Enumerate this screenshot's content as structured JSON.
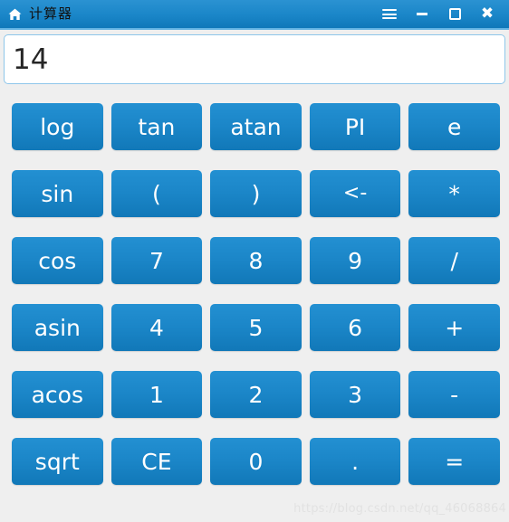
{
  "window": {
    "title": "计算器",
    "home_icon": "home-icon",
    "controls": [
      {
        "name": "menu-button",
        "icon": "hamburger-icon",
        "label": ""
      },
      {
        "name": "minimize-button",
        "icon": "minimize-icon",
        "label": ""
      },
      {
        "name": "maximize-button",
        "icon": "maximize-icon",
        "label": ""
      },
      {
        "name": "close-button",
        "icon": "close-icon",
        "label": "✖"
      }
    ],
    "titlebar_color": "#1a86c8",
    "titlebar_accent": "#63b4e4",
    "title_text_color": "#111111"
  },
  "display": {
    "value": "14",
    "placeholder": "",
    "background": "#ffffff",
    "border_color": "#8ec6ea",
    "text_color": "#262626"
  },
  "keypad": {
    "button_color": "#1b86c8",
    "button_text_color": "#ffffff",
    "rows": [
      {
        "keys": [
          {
            "label": "log"
          },
          {
            "label": "tan"
          },
          {
            "label": "atan"
          },
          {
            "label": "PI"
          },
          {
            "label": "e"
          }
        ]
      },
      {
        "keys": [
          {
            "label": "sin"
          },
          {
            "label": "("
          },
          {
            "label": ")"
          },
          {
            "label": "<-"
          },
          {
            "label": "*"
          }
        ]
      },
      {
        "keys": [
          {
            "label": "cos"
          },
          {
            "label": "7"
          },
          {
            "label": "8"
          },
          {
            "label": "9"
          },
          {
            "label": "/"
          }
        ]
      },
      {
        "keys": [
          {
            "label": "asin"
          },
          {
            "label": "4"
          },
          {
            "label": "5"
          },
          {
            "label": "6"
          },
          {
            "label": "+"
          }
        ]
      },
      {
        "keys": [
          {
            "label": "acos"
          },
          {
            "label": "1"
          },
          {
            "label": "2"
          },
          {
            "label": "3"
          },
          {
            "label": "-"
          }
        ]
      },
      {
        "keys": [
          {
            "label": "sqrt"
          },
          {
            "label": "CE"
          },
          {
            "label": "0"
          },
          {
            "label": "."
          },
          {
            "label": "="
          }
        ]
      }
    ]
  },
  "watermark": {
    "text": "https://blog.csdn.net/qq_46068864"
  },
  "background_color": "#efefef"
}
